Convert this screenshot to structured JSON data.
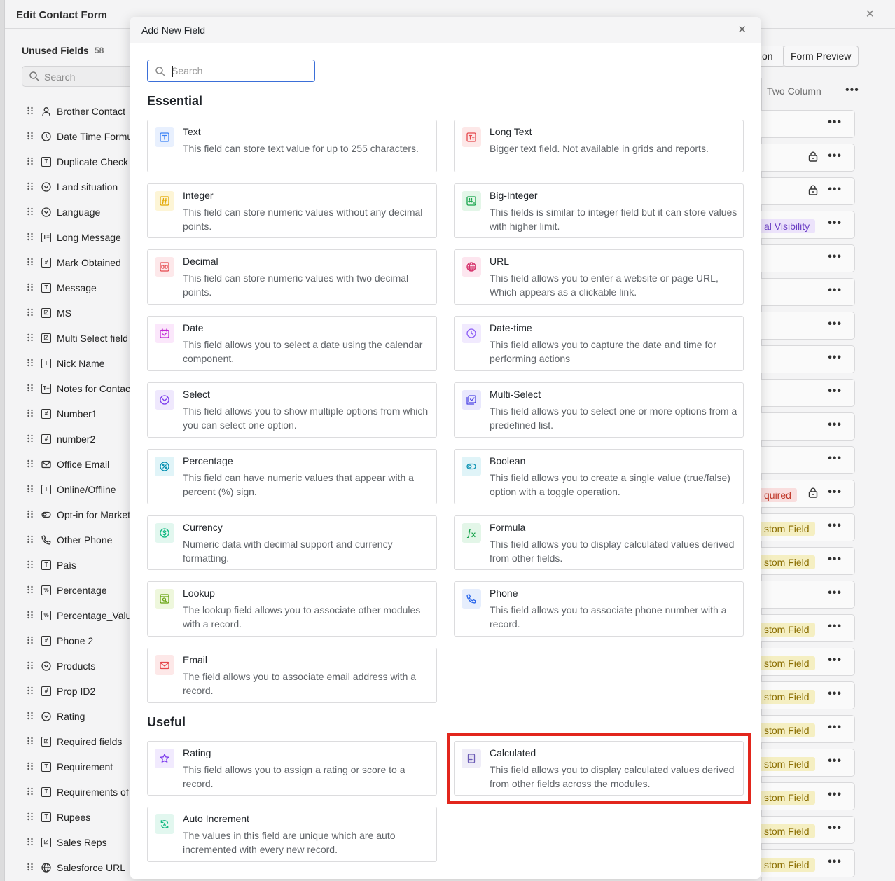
{
  "background": {
    "window_title": "Edit Contact Form",
    "unused_fields_title": "Unused Fields",
    "unused_fields_count": "58",
    "search_placeholder": "Search",
    "unused_fields": [
      {
        "label": "Brother Contact",
        "icon": "person-icon"
      },
      {
        "label": "Date Time Formula",
        "icon": "clock-icon"
      },
      {
        "label": "Duplicate Check",
        "icon": "text-field-icon"
      },
      {
        "label": "Land situation",
        "icon": "select-icon"
      },
      {
        "label": "Language",
        "icon": "select-icon"
      },
      {
        "label": "Long Message",
        "icon": "long-text-icon"
      },
      {
        "label": "Mark Obtained",
        "icon": "number-icon"
      },
      {
        "label": "Message",
        "icon": "text-field-icon"
      },
      {
        "label": "MS",
        "icon": "multi-select-icon"
      },
      {
        "label": "Multi Select field",
        "icon": "multi-select-icon"
      },
      {
        "label": "Nick Name",
        "icon": "text-field-icon"
      },
      {
        "label": "Notes for Contact",
        "icon": "long-text-icon"
      },
      {
        "label": "Number1",
        "icon": "number-icon"
      },
      {
        "label": "number2",
        "icon": "number-icon"
      },
      {
        "label": "Office Email",
        "icon": "email-icon"
      },
      {
        "label": "Online/Offline",
        "icon": "text-field-icon"
      },
      {
        "label": "Opt-in for Marketing",
        "icon": "toggle-icon"
      },
      {
        "label": "Other Phone",
        "icon": "phone-icon"
      },
      {
        "label": "País",
        "icon": "text-field-icon"
      },
      {
        "label": "Percentage",
        "icon": "percent-icon"
      },
      {
        "label": "Percentage_Value",
        "icon": "percent-icon"
      },
      {
        "label": "Phone 2",
        "icon": "number-icon"
      },
      {
        "label": "Products",
        "icon": "select-icon"
      },
      {
        "label": "Prop ID2",
        "icon": "number-icon"
      },
      {
        "label": "Rating",
        "icon": "select-icon"
      },
      {
        "label": "Required fields",
        "icon": "multi-select-icon"
      },
      {
        "label": "Requirement",
        "icon": "text-field-icon"
      },
      {
        "label": "Requirements of",
        "icon": "text-field-icon"
      },
      {
        "label": "Rupees",
        "icon": "text-field-icon"
      },
      {
        "label": "Sales Reps",
        "icon": "multi-select-icon"
      },
      {
        "label": "Salesforce URL",
        "icon": "globe-icon"
      }
    ],
    "buttons": {
      "layout_partial": "on",
      "form_preview": "Form Preview"
    },
    "layout_label": "Two Column",
    "right_rows": [
      {
        "badge": "",
        "lock": false
      },
      {
        "badge": "",
        "lock": true
      },
      {
        "badge": "",
        "lock": true
      },
      {
        "badge": "al Visibility",
        "badge_type": "purple",
        "lock": false
      },
      {
        "badge": "",
        "lock": false
      },
      {
        "badge": "",
        "lock": false
      },
      {
        "badge": "",
        "lock": false
      },
      {
        "badge": "",
        "lock": false
      },
      {
        "badge": "",
        "lock": false
      },
      {
        "badge": "",
        "lock": false
      },
      {
        "badge": "",
        "lock": false
      },
      {
        "badge": "quired",
        "badge_type": "red",
        "lock": true
      },
      {
        "badge": "stom Field",
        "badge_type": "yellow",
        "lock": false
      },
      {
        "badge": "stom Field",
        "badge_type": "yellow",
        "lock": false
      },
      {
        "badge": "",
        "lock": false
      },
      {
        "badge": "stom Field",
        "badge_type": "yellow",
        "lock": false
      },
      {
        "badge": "stom Field",
        "badge_type": "yellow",
        "lock": false
      },
      {
        "badge": "stom Field",
        "badge_type": "yellow",
        "lock": false
      },
      {
        "badge": "stom Field",
        "badge_type": "yellow",
        "lock": false
      },
      {
        "badge": "stom Field",
        "badge_type": "yellow",
        "lock": false
      },
      {
        "badge": "stom Field",
        "badge_type": "yellow",
        "lock": false
      },
      {
        "badge": "stom Field",
        "badge_type": "yellow",
        "lock": false
      },
      {
        "badge": "stom Field",
        "badge_type": "yellow",
        "lock": false
      }
    ],
    "badge_colors": {
      "purple": {
        "bg": "#ece3fb",
        "fg": "#6b3fc4"
      },
      "red": {
        "bg": "#f9dede",
        "fg": "#c0392b"
      },
      "yellow": {
        "bg": "#f5efc2",
        "fg": "#8a6d00"
      }
    }
  },
  "modal": {
    "title": "Add New Field",
    "search_placeholder": "Search",
    "sections": [
      {
        "title": "Essential",
        "fields": [
          {
            "title": "Text",
            "desc": "This field can store text value for up to 255 characters.",
            "icon": "text-icon",
            "color": "#3b82f6",
            "bg": "#e8f0fe"
          },
          {
            "title": "Long Text",
            "desc": "Bigger text field. Not available in grids and reports.",
            "icon": "long-text-icon",
            "color": "#e5484d",
            "bg": "#fde8e8"
          },
          {
            "title": "Integer",
            "desc": "This field can store numeric values without any decimal points.",
            "icon": "integer-icon",
            "color": "#e2a700",
            "bg": "#fdf5d6"
          },
          {
            "title": "Big-Integer",
            "desc": "This fields is similar to integer field but it can store values with higher limit.",
            "icon": "big-integer-icon",
            "color": "#16a34a",
            "bg": "#e3f6e8"
          },
          {
            "title": "Decimal",
            "desc": "This field can store numeric values with two decimal points.",
            "icon": "decimal-icon",
            "color": "#e5484d",
            "bg": "#fde8ea"
          },
          {
            "title": "URL",
            "desc": "This field allows you to enter a website or page URL, Which appears as a clickable link.",
            "icon": "globe-icon",
            "color": "#d6336c",
            "bg": "#fde6ef"
          },
          {
            "title": "Date",
            "desc": "This field allows you to select a date using the calendar component.",
            "icon": "calendar-icon",
            "color": "#c026d3",
            "bg": "#fbe7fb"
          },
          {
            "title": "Date-time",
            "desc": "This field allows you to capture the date and time for performing actions",
            "icon": "clock-icon",
            "color": "#8b5cf6",
            "bg": "#f1eafe"
          },
          {
            "title": "Select",
            "desc": "This field allows you to show multiple options from which you can select one option.",
            "icon": "select-icon",
            "color": "#7c3aed",
            "bg": "#efe8fd"
          },
          {
            "title": "Multi-Select",
            "desc": "This field allows you to select one or more options from a predefined list.",
            "icon": "multi-select-icon",
            "color": "#4f46e5",
            "bg": "#e9e8fd"
          },
          {
            "title": "Percentage",
            "desc": "This field can have numeric values that appear with a percent (%) sign.",
            "icon": "percent-icon",
            "color": "#0891b2",
            "bg": "#e0f4f8"
          },
          {
            "title": "Boolean",
            "desc": "This field allows you to create a single value (true/false) option with a toggle operation.",
            "icon": "toggle-icon",
            "color": "#0891b2",
            "bg": "#e0f4f8"
          },
          {
            "title": "Currency",
            "desc": "Numeric data with decimal support and currency formatting.",
            "icon": "currency-icon",
            "color": "#10b981",
            "bg": "#e2f7ef"
          },
          {
            "title": "Formula",
            "desc": "This field allows you to display calculated values derived from other fields.",
            "icon": "formula-icon",
            "color": "#16a34a",
            "bg": "#e3f6e8"
          },
          {
            "title": "Lookup",
            "desc": "The lookup field allows you to associate other modules with a record.",
            "icon": "lookup-icon",
            "color": "#65a30d",
            "bg": "#eef7dc"
          },
          {
            "title": "Phone",
            "desc": "This field allows you to associate phone number with a record.",
            "icon": "phone-icon",
            "color": "#2563eb",
            "bg": "#e6eefd"
          },
          {
            "title": "Email",
            "desc": "The field allows you to associate email address with a record.",
            "icon": "email-icon",
            "color": "#e5484d",
            "bg": "#fde8e8"
          }
        ]
      },
      {
        "title": "Useful",
        "fields": [
          {
            "title": "Rating",
            "desc": "This field allows you to assign a rating or score to a record.",
            "icon": "star-icon",
            "color": "#7c3aed",
            "bg": "#f1eafe"
          },
          {
            "title": "Calculated",
            "desc": "This field allows you to display calculated values derived from other fields across the modules.",
            "icon": "calculator-icon",
            "color": "#6b5bb5",
            "bg": "#efedf8"
          },
          {
            "title": "Auto Increment",
            "desc": "The values in this field are unique which are auto incremented with every new record.",
            "icon": "auto-increment-icon",
            "color": "#10b981",
            "bg": "#e2f7ef"
          }
        ]
      }
    ]
  }
}
